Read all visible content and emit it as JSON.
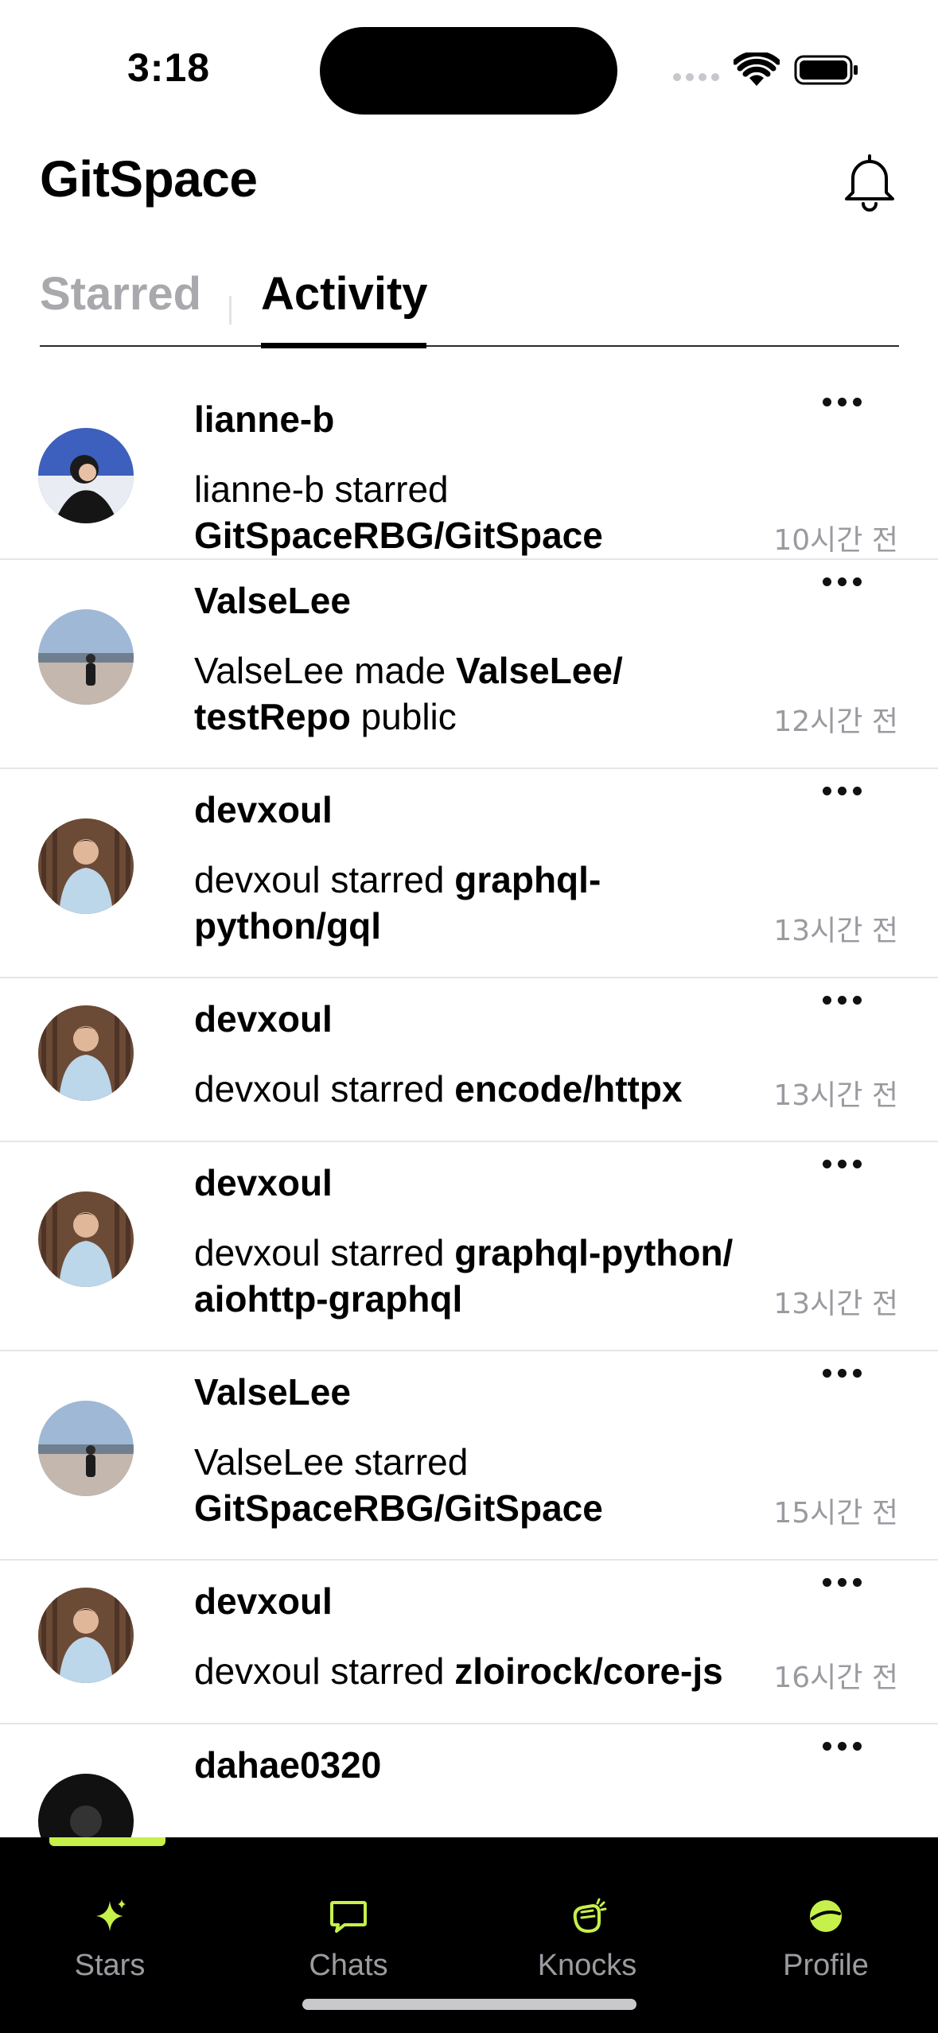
{
  "status_bar": {
    "time": "3:18"
  },
  "header": {
    "title": "GitSpace"
  },
  "tabs": [
    {
      "label": "Starred",
      "active": false
    },
    {
      "label": "Activity",
      "active": true
    }
  ],
  "feed": [
    {
      "user": "lianne-b",
      "parts": [
        "lianne-b starred ",
        "GitSpaceRBG/GitSpace",
        ""
      ],
      "time": "10시간 전"
    },
    {
      "user": "ValseLee",
      "parts": [
        "ValseLee made ",
        "ValseLee/testRepo",
        " public"
      ],
      "time": "12시간 전"
    },
    {
      "user": "devxoul",
      "parts": [
        "devxoul starred ",
        "graphql-python/gql",
        ""
      ],
      "time": "13시간 전"
    },
    {
      "user": "devxoul",
      "parts": [
        "devxoul starred ",
        "encode/httpx",
        ""
      ],
      "time": "13시간 전"
    },
    {
      "user": "devxoul",
      "parts": [
        "devxoul starred ",
        "graphql-python/aiohttp-graphql",
        ""
      ],
      "time": "13시간 전"
    },
    {
      "user": "ValseLee",
      "parts": [
        "ValseLee starred ",
        "GitSpaceRBG/GitSpace",
        ""
      ],
      "time": "15시간 전"
    },
    {
      "user": "devxoul",
      "parts": [
        "devxoul starred ",
        "zloirock/core-js",
        ""
      ],
      "time": "16시간 전"
    },
    {
      "user": "dahae0320",
      "parts": [
        "",
        "",
        ""
      ],
      "time": ""
    }
  ],
  "tabbar": {
    "items": [
      {
        "label": "Stars",
        "icon": "sparkles-icon"
      },
      {
        "label": "Chats",
        "icon": "chat-bubble-icon"
      },
      {
        "label": "Knocks",
        "icon": "knock-hand-icon"
      },
      {
        "label": "Profile",
        "icon": "planet-icon"
      }
    ],
    "accent": "#c6f04a"
  }
}
